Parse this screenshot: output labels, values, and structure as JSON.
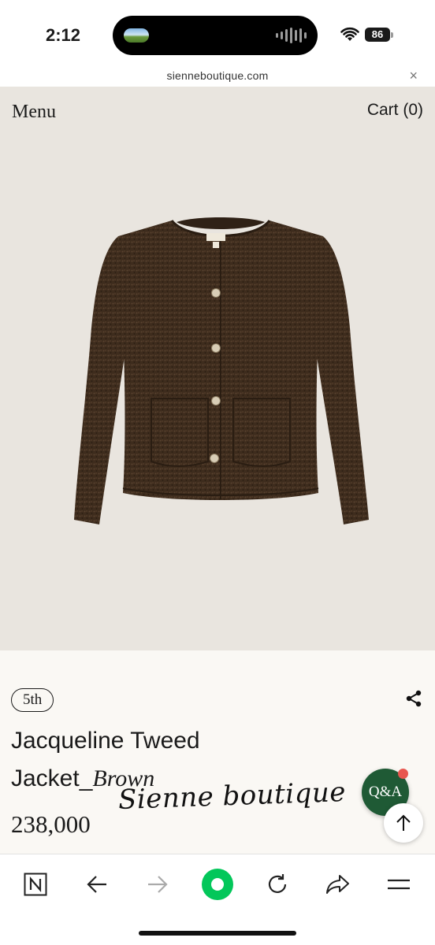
{
  "status": {
    "time": "2:12",
    "battery": "86"
  },
  "browser": {
    "url": "sienneboutique.com",
    "close_label": "×"
  },
  "header": {
    "menu_label": "Menu",
    "cart_label": "Cart (0)"
  },
  "product": {
    "image_icon": "tweed-jacket-photo",
    "edition": "5th",
    "name_line1": "Jacqueline Tweed",
    "name_line2_prefix": "Jacket_",
    "name_line2_color": "Brown",
    "price": "238,000",
    "watermark": "Sienne boutique"
  },
  "floating": {
    "qa_label": "Q&A",
    "scroll_top_icon": "arrow-up-icon"
  },
  "toolbar": {
    "items": [
      "n-logo-icon",
      "back-arrow-icon",
      "forward-arrow-icon",
      "green-dot-icon",
      "reload-icon",
      "share-arrow-icon",
      "menu-lines-icon"
    ]
  },
  "colors": {
    "hero_bg": "#e9e5df",
    "info_bg": "#faf8f4",
    "qa_green": "#1f5a35",
    "browser_green": "#03c75a",
    "notif_red": "#e8574f"
  }
}
